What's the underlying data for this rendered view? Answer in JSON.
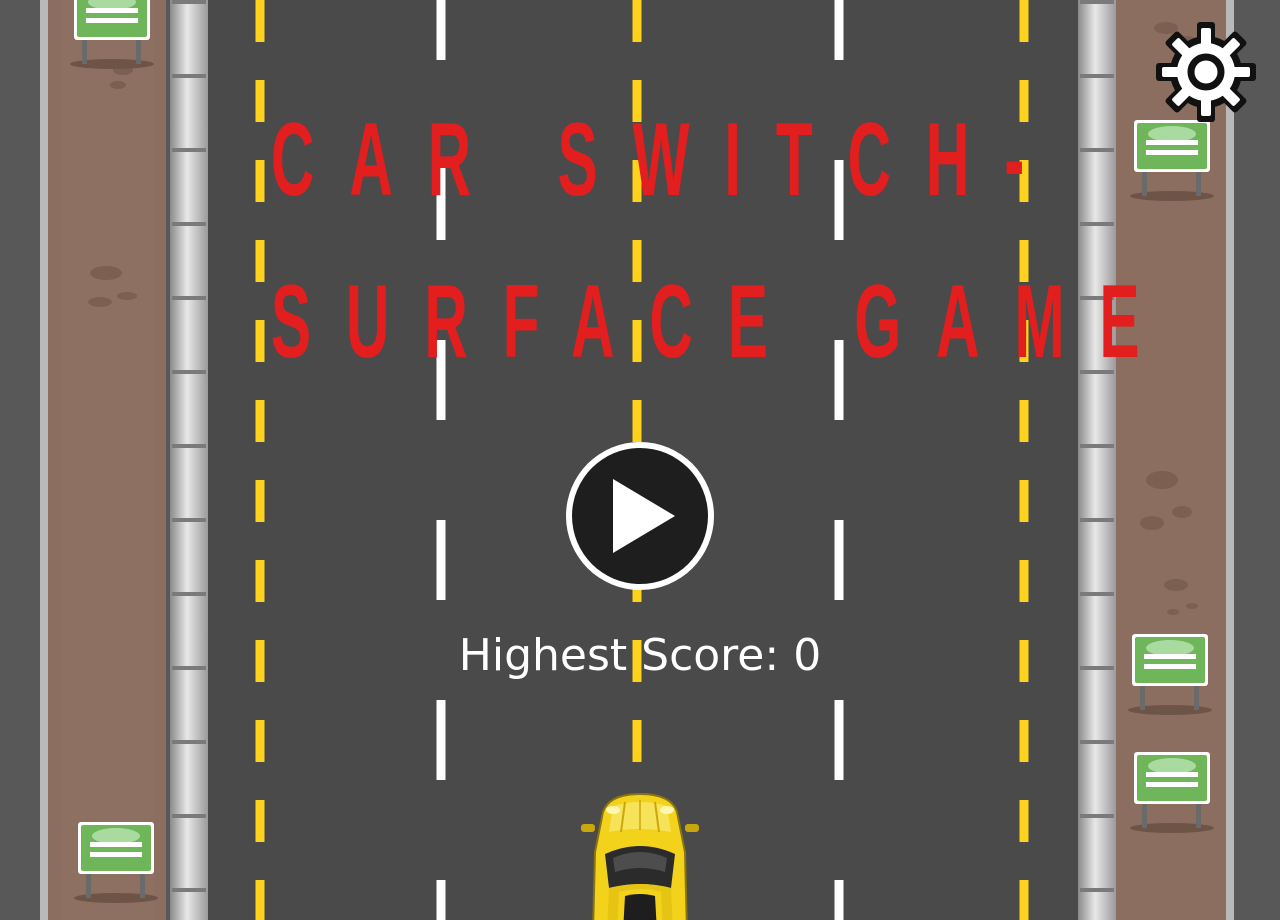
{
  "game": {
    "title_line_1": "CAR SWITCH-",
    "title_line_2": "SURFACE GAME",
    "score_label": "Highest Score:",
    "score_value": "0",
    "colors": {
      "title": "#e21e1e",
      "asphalt": "#4a4a4a",
      "dirt": "#8c6e5e",
      "lane_yellow": "#ffd21e",
      "lane_white": "#ffffff",
      "sign_green": "#6fb55a",
      "player_car": "#f2d21a"
    }
  },
  "icons": {
    "play": "play-icon",
    "settings": "gear-icon",
    "player_car": "car-icon",
    "roadside_sign": "sign-icon"
  }
}
